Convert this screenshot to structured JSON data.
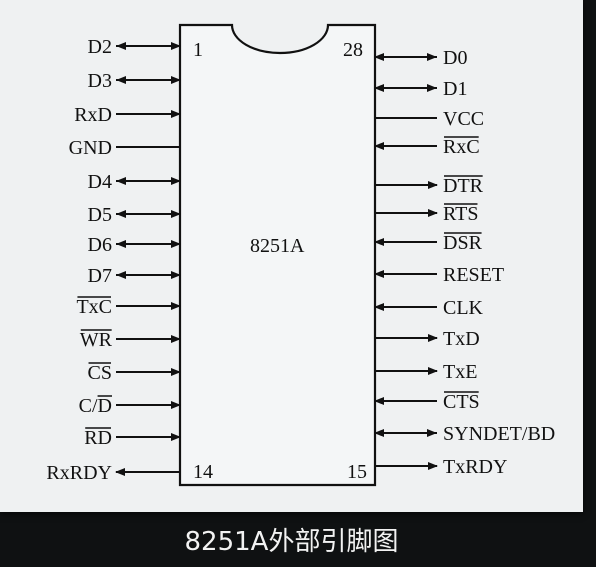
{
  "chip": {
    "name": "8251A",
    "corner_pins": {
      "top_left": "1",
      "top_right": "28",
      "bottom_left": "14",
      "bottom_right": "15"
    }
  },
  "pins": {
    "left": [
      {
        "label": "D2",
        "direction": "bidir",
        "overbar": false
      },
      {
        "label": "D3",
        "direction": "bidir",
        "overbar": false
      },
      {
        "label": "RxD",
        "direction": "in",
        "overbar": false
      },
      {
        "label": "GND",
        "direction": "none",
        "overbar": false
      },
      {
        "label": "D4",
        "direction": "bidir",
        "overbar": false
      },
      {
        "label": "D5",
        "direction": "bidir",
        "overbar": false
      },
      {
        "label": "D6",
        "direction": "bidir",
        "overbar": false
      },
      {
        "label": "D7",
        "direction": "bidir",
        "overbar": false
      },
      {
        "label": "TxC",
        "direction": "in",
        "overbar": true
      },
      {
        "label": "WR",
        "direction": "in",
        "overbar": true
      },
      {
        "label": "CS",
        "direction": "in",
        "overbar": true
      },
      {
        "label": "C/D",
        "direction": "in",
        "overbar": false,
        "overbar_part": "D"
      },
      {
        "label": "RD",
        "direction": "in",
        "overbar": true
      },
      {
        "label": "RxRDY",
        "direction": "out",
        "overbar": false
      }
    ],
    "right": [
      {
        "label": "D0",
        "direction": "bidir",
        "overbar": false
      },
      {
        "label": "D1",
        "direction": "bidir",
        "overbar": false
      },
      {
        "label": "VCC",
        "direction": "none",
        "overbar": false
      },
      {
        "label": "RxC",
        "direction": "in",
        "overbar": true
      },
      {
        "label": "DTR",
        "direction": "out",
        "overbar": true
      },
      {
        "label": "RTS",
        "direction": "out",
        "overbar": true
      },
      {
        "label": "DSR",
        "direction": "in",
        "overbar": true
      },
      {
        "label": "RESET",
        "direction": "in",
        "overbar": false
      },
      {
        "label": "CLK",
        "direction": "in",
        "overbar": false
      },
      {
        "label": "TxD",
        "direction": "out",
        "overbar": false
      },
      {
        "label": "TxE",
        "direction": "out",
        "overbar": false
      },
      {
        "label": "CTS",
        "direction": "in",
        "overbar": true
      },
      {
        "label": "SYNDET/BD",
        "direction": "bidir",
        "overbar": false
      },
      {
        "label": "TxRDY",
        "direction": "out",
        "overbar": false
      }
    ]
  },
  "caption": "8251A外部引脚图",
  "colors": {
    "panel": "#eff1f2",
    "ink": "#111111",
    "background": "#0f1112"
  }
}
